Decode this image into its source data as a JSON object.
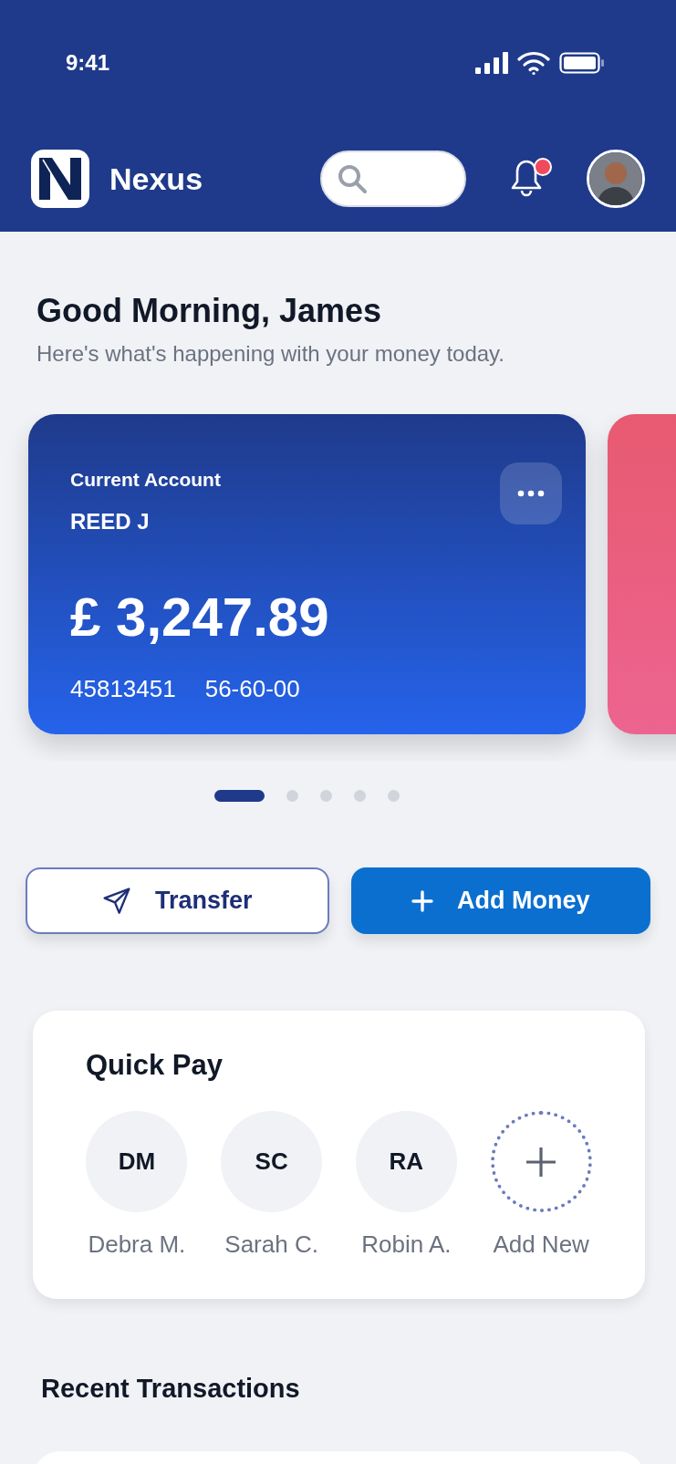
{
  "status_bar": {
    "time": "9:41"
  },
  "app_bar": {
    "title": "Nexus",
    "notifications_unread": true
  },
  "greeting": {
    "title": "Good Morning, James",
    "subtitle": "Here's what's happening with your money today."
  },
  "accounts": [
    {
      "kind": "account",
      "label": "Current Account",
      "holder": "REED J",
      "balance": "£ 3,247.89",
      "account_number": "45813451",
      "sort_code": "56-60-00",
      "color": "#2563eb"
    },
    {
      "kind": "partial",
      "color": "#e85a70"
    }
  ],
  "carousel_dots": [
    {
      "selected": true
    },
    {
      "selected": false
    },
    {
      "selected": false
    },
    {
      "selected": false
    },
    {
      "selected": false
    }
  ],
  "actions": [
    {
      "kind": "transfer",
      "label": "Transfer"
    },
    {
      "kind": "add",
      "label": "Add Money"
    }
  ],
  "quick_pay": {
    "title": "Quick Pay",
    "contacts": [
      {
        "kind": "contact",
        "initials": "DM",
        "name": "Debra M."
      },
      {
        "kind": "contact",
        "initials": "SC",
        "name": "Sarah C."
      },
      {
        "kind": "contact",
        "initials": "RA",
        "name": "Robin A."
      },
      {
        "kind": "add",
        "name": "Add New"
      }
    ]
  },
  "recent_transactions": {
    "title": "Recent Transactions"
  }
}
